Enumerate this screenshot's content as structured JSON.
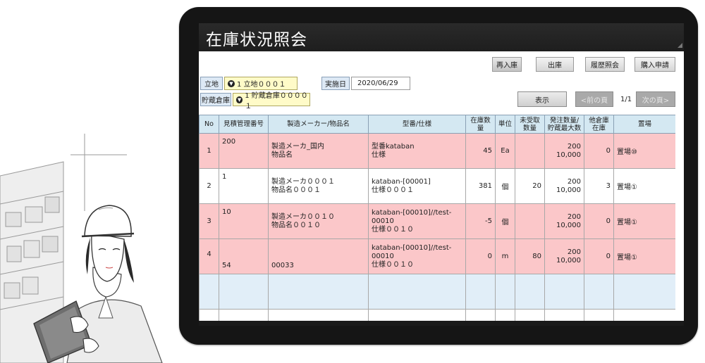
{
  "app": {
    "title": "在庫状況照会"
  },
  "toolbar": {
    "restock_label": "再入庫",
    "issue_label": "出庫",
    "history_label": "履歴照会",
    "purchase_label": "購入申請"
  },
  "filter": {
    "location_label": "立地",
    "location_value": "1 立地０００１",
    "date_label": "実施日",
    "date_value": "2020/06/29",
    "warehouse_label": "貯蔵倉庫",
    "warehouse_value": "1 貯蔵倉庫００００１",
    "display_label": "表示",
    "prev_label": "<前の頁",
    "page_indicator": "1/1",
    "next_label": "次の頁>"
  },
  "table": {
    "headers": {
      "no": "No",
      "estimate": "見積管理番号",
      "maker_item": "製造メーカー/物品名",
      "model_spec": "型番/仕様",
      "stock": "在庫数量",
      "unit": "単位",
      "unreceived_1": "未受取",
      "unreceived_2": "数量",
      "order_1": "発注数量/",
      "order_2": "貯蔵最大数",
      "other_1": "他倉庫",
      "other_2": "在庫",
      "place": "置場"
    },
    "rows": [
      {
        "no": "1",
        "estimate": "200",
        "maker": "製造メーカ_国内",
        "item": "物品名",
        "model": "型番kataban",
        "spec": "仕様",
        "stock": "45",
        "unit": "Ea",
        "unreceived": "",
        "order": "200",
        "max": "10,000",
        "other": "0",
        "place": "置場⑩"
      },
      {
        "no": "2",
        "estimate": "1",
        "maker": "製造メーカ０００１",
        "item": "物品名０００１",
        "model": "kataban-[00001]",
        "spec": "仕様０００１",
        "stock": "381",
        "unit": "個",
        "unreceived": "20",
        "order": "200",
        "max": "10,000",
        "other": "3",
        "place": "置場①"
      },
      {
        "no": "3",
        "estimate": "10",
        "maker": "製造メーカ００１０",
        "item": "物品名００１０",
        "model": "kataban-[00010]//test-00010",
        "spec": "仕様００１０",
        "stock": "-5",
        "unit": "個",
        "unreceived": "",
        "order": "200",
        "max": "10,000",
        "other": "0",
        "place": "置場①"
      },
      {
        "no": "4",
        "estimate": "54",
        "maker": "",
        "item": "00033",
        "model": "kataban-[00010]//test-00010",
        "spec": "仕様００１０",
        "stock": "0",
        "unit": "m",
        "unreceived": "80",
        "order": "200",
        "max": "10,000",
        "other": "0",
        "place": "置場①"
      }
    ]
  },
  "colors": {
    "pink_row": "#fbc7c9",
    "header_bg": "#d4e8f2",
    "select_bg": "#fffbc8",
    "label_bg": "#dde9f5",
    "title_bar": "#1e1e1e"
  },
  "icons": {
    "dropdown": "chevron-down-circle-icon",
    "grip": "resize-grip-icon"
  }
}
